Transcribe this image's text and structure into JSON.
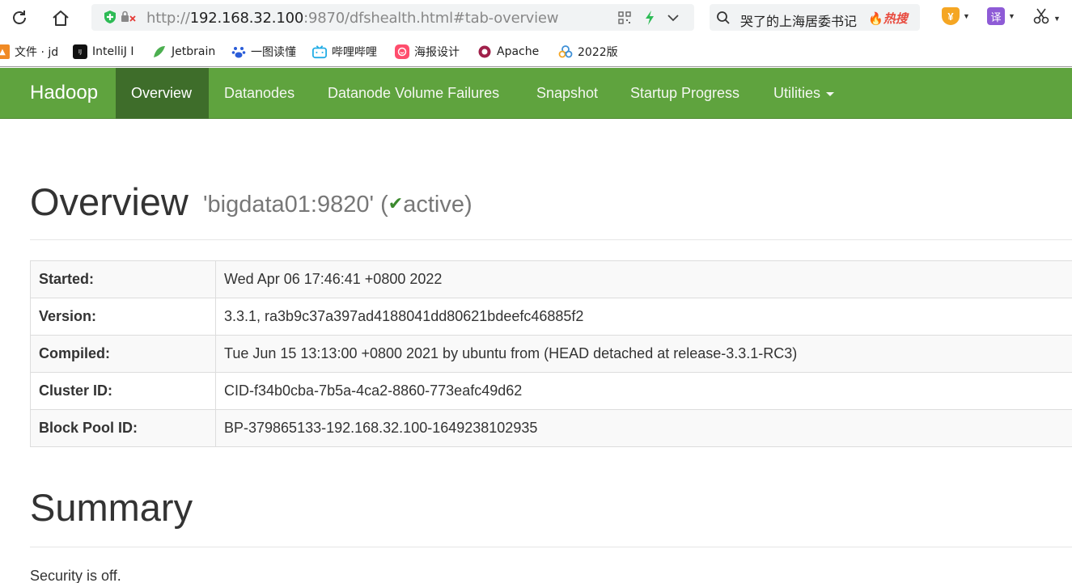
{
  "browser": {
    "url_prefix": "http://",
    "url_host": "192.168.32.100",
    "url_rest": ":9870/dfshealth.html#tab-overview",
    "search_query": "哭了的上海居委书记",
    "search_hot": "热搜",
    "ext_translate": "译",
    "ext_money": "¥"
  },
  "bookmarks": [
    {
      "label": "文件 · jd",
      "icon": "folder-icon",
      "color": "#f08a24"
    },
    {
      "label": "IntelliJ I",
      "icon": "intellij-icon",
      "color": "#111111"
    },
    {
      "label": "Jetbrain",
      "icon": "jetbrains-icon",
      "color": "#4caf50"
    },
    {
      "label": "一图读懂",
      "icon": "baidu-paw-icon",
      "color": "#2a5cd8"
    },
    {
      "label": "哔哩哔哩",
      "icon": "bilibili-icon",
      "color": "#23ade5"
    },
    {
      "label": "海报设计",
      "icon": "poster-icon",
      "color": "#ff4d6d"
    },
    {
      "label": "Apache",
      "icon": "apache-icon",
      "color": "#a0204a"
    },
    {
      "label": "2022版",
      "icon": "cloud-icon",
      "color": "#3d8fd6"
    }
  ],
  "navbar": {
    "brand": "Hadoop",
    "items": [
      {
        "label": "Overview",
        "active": true
      },
      {
        "label": "Datanodes",
        "active": false
      },
      {
        "label": "Datanode Volume Failures",
        "active": false
      },
      {
        "label": "Snapshot",
        "active": false
      },
      {
        "label": "Startup Progress",
        "active": false
      },
      {
        "label": "Utilities",
        "active": false,
        "dropdown": true
      }
    ]
  },
  "overview": {
    "title": "Overview",
    "host": "'bigdata01:9820' (",
    "status": "active)",
    "rows": [
      {
        "key": "Started:",
        "value": "Wed Apr 06 17:46:41 +0800 2022"
      },
      {
        "key": "Version:",
        "value": "3.3.1, ra3b9c37a397ad4188041dd80621bdeefc46885f2"
      },
      {
        "key": "Compiled:",
        "value": "Tue Jun 15 13:13:00 +0800 2021 by ubuntu from (HEAD detached at release-3.3.1-RC3)"
      },
      {
        "key": "Cluster ID:",
        "value": "CID-f34b0cba-7b5a-4ca2-8860-773eafc49d62"
      },
      {
        "key": "Block Pool ID:",
        "value": "BP-379865133-192.168.32.100-1649238102935"
      }
    ]
  },
  "summary": {
    "title": "Summary",
    "security": "Security is off."
  },
  "colors": {
    "navbar": "#5fa33e",
    "navbar_active": "#3e6d2a",
    "check": "#3c8a2e"
  }
}
